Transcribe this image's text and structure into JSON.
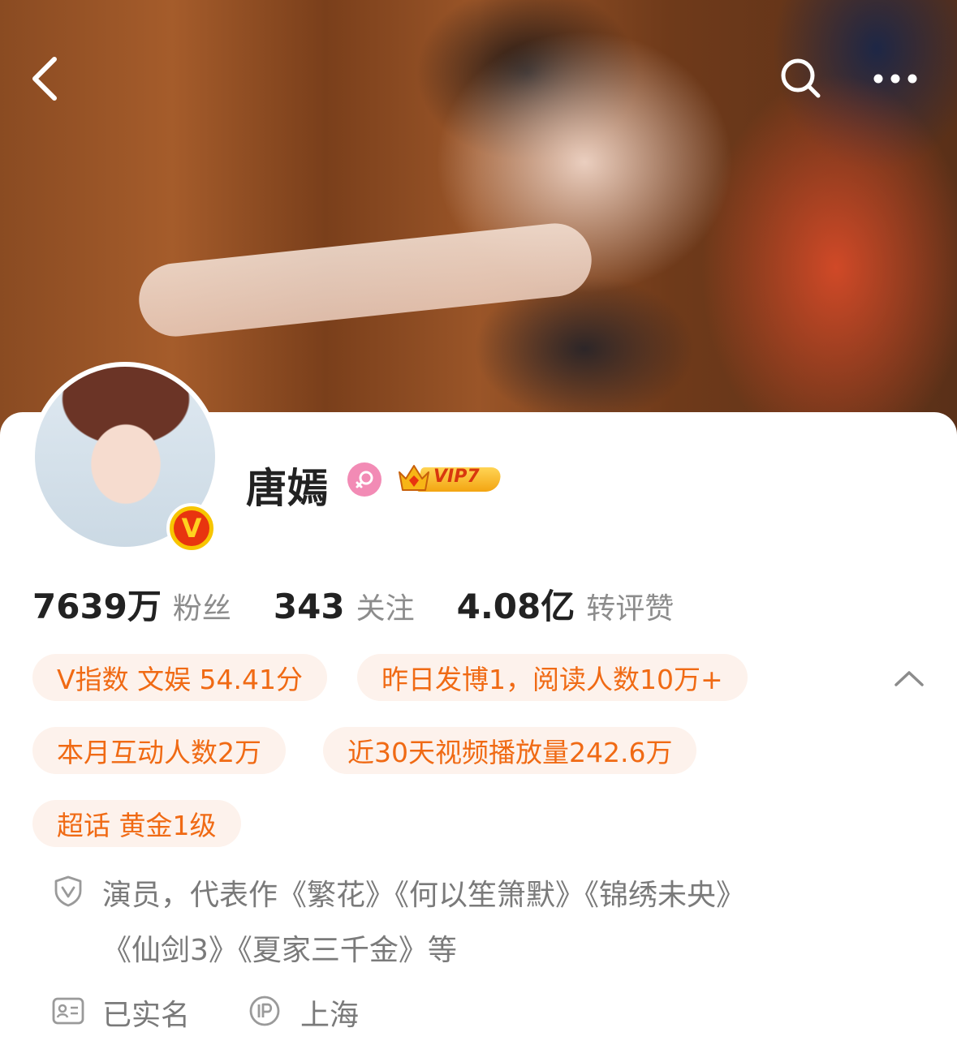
{
  "header": {
    "back_icon": "chevron-left-icon",
    "search_icon": "search-icon",
    "more_icon": "more-horizontal-icon"
  },
  "profile": {
    "name": "唐嫣",
    "gender_icon": "female-icon",
    "vip_label": "VIP7",
    "verified_badge": "V"
  },
  "stats": [
    {
      "value": "7639万",
      "label": "粉丝"
    },
    {
      "value": "343",
      "label": "关注"
    },
    {
      "value": "4.08亿",
      "label": "转评赞"
    }
  ],
  "tags": [
    "V指数 文娱 54.41分",
    "昨日发博1，阅读人数10万+",
    "本月互动人数2万",
    "近30天视频播放量242.6万",
    "超话 黄金1级"
  ],
  "bio": {
    "line1": "演员，代表作《繁花》《何以笙箫默》《锦绣未央》",
    "line2": "《仙剑3》《夏家三千金》等"
  },
  "meta": {
    "realname": "已实名",
    "location": "上海"
  },
  "colors": {
    "tag_text": "#f06a14",
    "tag_bg": "#fdf2ec",
    "name": "#222222",
    "secondary": "#8c8c8c"
  }
}
